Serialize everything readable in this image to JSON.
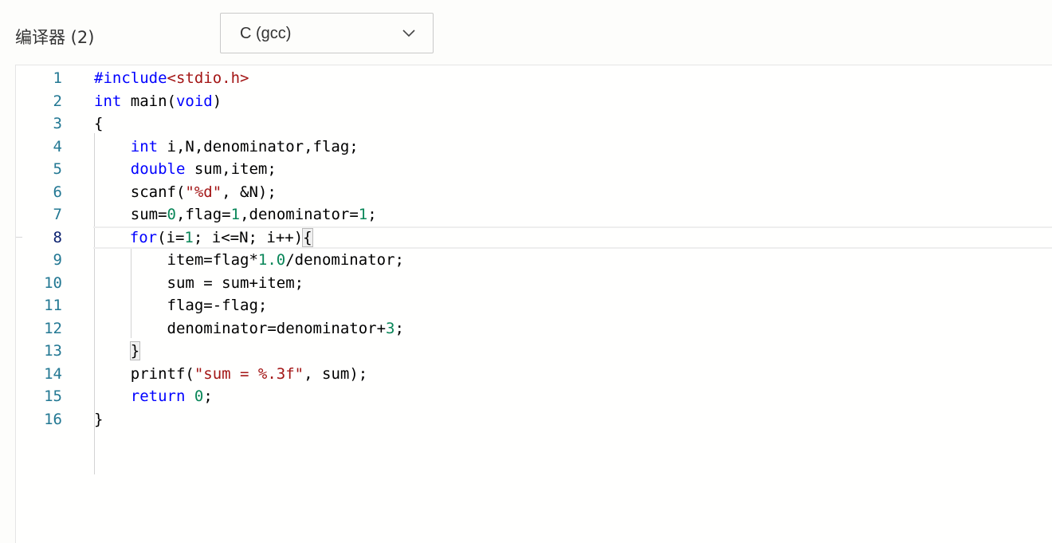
{
  "toolbar": {
    "compiler_label": "编译器 (2)",
    "compiler_value": "C (gcc)"
  },
  "colors": {
    "keyword": "#0000ff",
    "number": "#098658",
    "string": "#a31515",
    "line_number": "#237893",
    "active_line_number": "#0b216f"
  },
  "icons": {
    "dropdown": "chevron-down-icon"
  },
  "editor": {
    "current_line": 8,
    "lines": [
      {
        "n": "1",
        "tokens": [
          [
            "kw",
            "#include"
          ],
          [
            "str",
            "<stdio.h>"
          ]
        ]
      },
      {
        "n": "2",
        "tokens": [
          [
            "kw",
            "int"
          ],
          [
            "",
            " main("
          ],
          [
            "kw",
            "void"
          ],
          [
            "",
            ")"
          ]
        ]
      },
      {
        "n": "3",
        "tokens": [
          [
            "",
            "{"
          ]
        ]
      },
      {
        "n": "4",
        "tokens": [
          [
            "",
            "    "
          ],
          [
            "kw",
            "int"
          ],
          [
            "",
            " i,N,denominator,flag;"
          ]
        ]
      },
      {
        "n": "5",
        "tokens": [
          [
            "",
            "    "
          ],
          [
            "kw",
            "double"
          ],
          [
            "",
            " sum,item;"
          ]
        ]
      },
      {
        "n": "6",
        "tokens": [
          [
            "",
            "    scanf("
          ],
          [
            "str",
            "\"%d\""
          ],
          [
            "",
            ", &N);"
          ]
        ]
      },
      {
        "n": "7",
        "tokens": [
          [
            "",
            "    sum="
          ],
          [
            "num",
            "0"
          ],
          [
            "",
            ",flag="
          ],
          [
            "num",
            "1"
          ],
          [
            "",
            ",denominator="
          ],
          [
            "num",
            "1"
          ],
          [
            "",
            ";"
          ]
        ]
      },
      {
        "n": "8",
        "tokens": [
          [
            "",
            "    "
          ],
          [
            "kw",
            "for"
          ],
          [
            "",
            "(i="
          ],
          [
            "num",
            "1"
          ],
          [
            "",
            "; i<=N; i++)"
          ],
          [
            "br",
            "{"
          ]
        ]
      },
      {
        "n": "9",
        "tokens": [
          [
            "",
            "        item=flag*"
          ],
          [
            "num",
            "1.0"
          ],
          [
            "",
            "/denominator;"
          ]
        ]
      },
      {
        "n": "10",
        "tokens": [
          [
            "",
            "        sum = sum+item;"
          ]
        ]
      },
      {
        "n": "11",
        "tokens": [
          [
            "",
            "        flag=-flag;"
          ]
        ]
      },
      {
        "n": "12",
        "tokens": [
          [
            "",
            "        denominator=denominator+"
          ],
          [
            "num",
            "3"
          ],
          [
            "",
            ";"
          ]
        ]
      },
      {
        "n": "13",
        "tokens": [
          [
            "",
            "    "
          ],
          [
            "br",
            "}"
          ]
        ]
      },
      {
        "n": "14",
        "tokens": [
          [
            "",
            "    printf("
          ],
          [
            "str",
            "\"sum = %.3f\""
          ],
          [
            "",
            ", sum);"
          ]
        ]
      },
      {
        "n": "15",
        "tokens": [
          [
            "",
            "    "
          ],
          [
            "kw",
            "return"
          ],
          [
            "",
            " "
          ],
          [
            "num",
            "0"
          ],
          [
            "",
            ";"
          ]
        ]
      },
      {
        "n": "16",
        "tokens": [
          [
            "",
            "}"
          ]
        ]
      }
    ]
  }
}
